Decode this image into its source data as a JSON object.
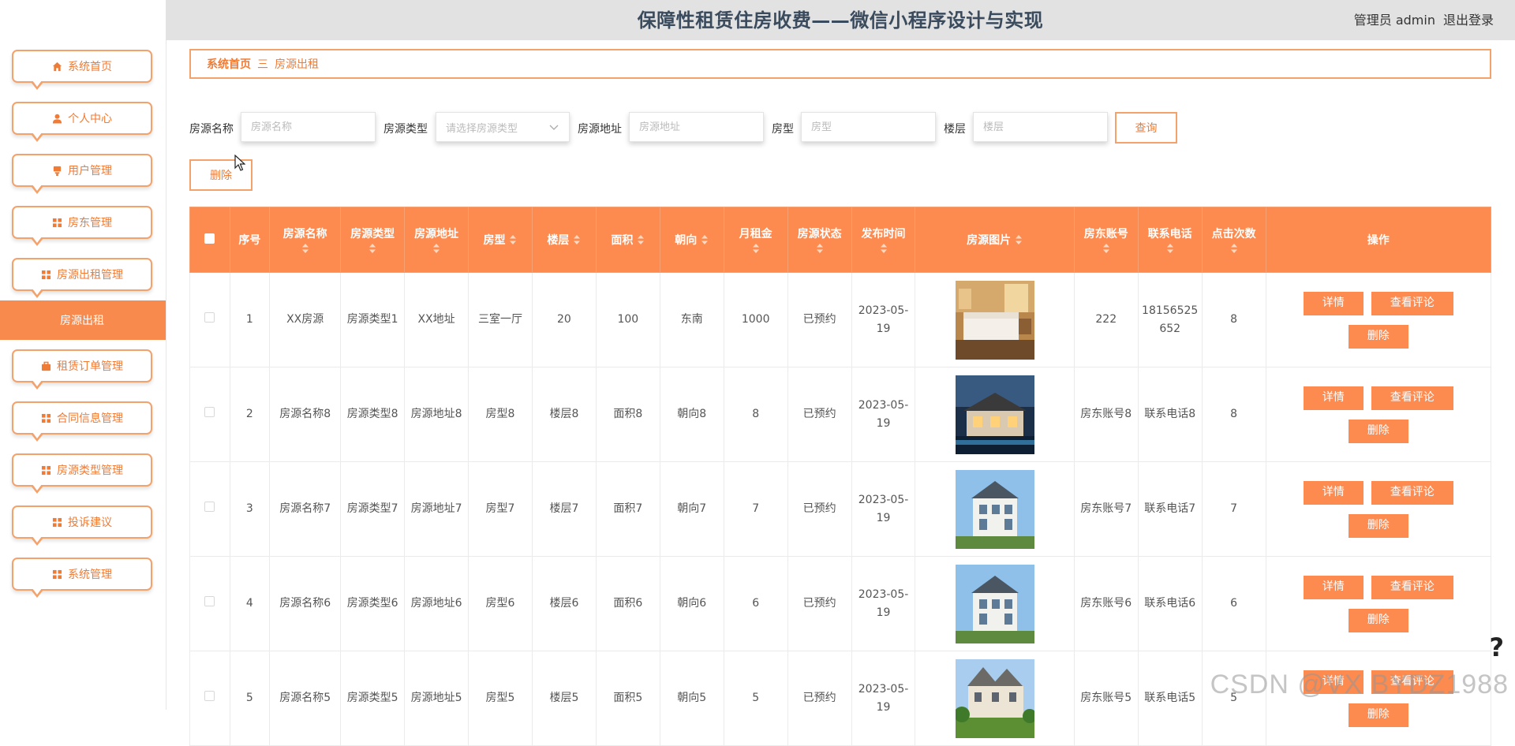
{
  "header": {
    "title": "保障性租赁住房收费——微信小程序设计与实现",
    "role": "管理员 admin",
    "logout": "退出登录"
  },
  "sidebar": {
    "items": [
      {
        "label": "系统首页",
        "icon": "home-icon"
      },
      {
        "label": "个人中心",
        "icon": "user-icon"
      },
      {
        "label": "用户管理",
        "icon": "user-manage-icon"
      },
      {
        "label": "房东管理",
        "icon": "grid-icon"
      },
      {
        "label": "房源出租管理",
        "icon": "grid-icon"
      },
      {
        "label": "租赁订单管理",
        "icon": "briefcase-icon"
      },
      {
        "label": "合同信息管理",
        "icon": "grid-icon"
      },
      {
        "label": "房源类型管理",
        "icon": "grid-icon"
      },
      {
        "label": "投诉建议",
        "icon": "grid-icon"
      },
      {
        "label": "系统管理",
        "icon": "grid-icon"
      }
    ],
    "active": "房源出租"
  },
  "breadcrumb": {
    "home": "系统首页",
    "sep": "三",
    "current": "房源出租"
  },
  "search": {
    "name_label": "房源名称",
    "name_placeholder": "房源名称",
    "type_label": "房源类型",
    "type_placeholder": "请选择房源类型",
    "addr_label": "房源地址",
    "addr_placeholder": "房源地址",
    "layout_label": "房型",
    "layout_placeholder": "房型",
    "floor_label": "楼层",
    "floor_placeholder": "楼层",
    "query_button": "查询",
    "delete_button": "删除"
  },
  "table": {
    "columns": [
      "序号",
      "房源名称",
      "房源类型",
      "房源地址",
      "房型",
      "楼层",
      "面积",
      "朝向",
      "月租金",
      "房源状态",
      "发布时间",
      "房源图片",
      "房东账号",
      "联系电话",
      "点击次数",
      "操作"
    ],
    "actions": {
      "detail": "详情",
      "comments": "查看评论",
      "delete": "删除"
    },
    "rows": [
      {
        "no": "1",
        "name": "XX房源",
        "type": "房源类型1",
        "addr": "XX地址",
        "layout": "三室一厅",
        "floor": "20",
        "area": "100",
        "orient": "东南",
        "rent": "1000",
        "status": "已预约",
        "time": "2023-05-19",
        "image": "hotel-room",
        "owner": "222",
        "phone": "18156525652",
        "clicks": "8"
      },
      {
        "no": "2",
        "name": "房源名称8",
        "type": "房源类型8",
        "addr": "房源地址8",
        "layout": "房型8",
        "floor": "楼层8",
        "area": "面积8",
        "orient": "朝向8",
        "rent": "8",
        "status": "已预约",
        "time": "2023-05-19",
        "image": "villa-night",
        "owner": "房东账号8",
        "phone": "联系电话8",
        "clicks": "8"
      },
      {
        "no": "3",
        "name": "房源名称7",
        "type": "房源类型7",
        "addr": "房源地址7",
        "layout": "房型7",
        "floor": "楼层7",
        "area": "面积7",
        "orient": "朝向7",
        "rent": "7",
        "status": "已预约",
        "time": "2023-05-19",
        "image": "villa-white",
        "owner": "房东账号7",
        "phone": "联系电话7",
        "clicks": "7"
      },
      {
        "no": "4",
        "name": "房源名称6",
        "type": "房源类型6",
        "addr": "房源地址6",
        "layout": "房型6",
        "floor": "楼层6",
        "area": "面积6",
        "orient": "朝向6",
        "rent": "6",
        "status": "已预约",
        "time": "2023-05-19",
        "image": "villa-white",
        "owner": "房东账号6",
        "phone": "联系电话6",
        "clicks": "6"
      },
      {
        "no": "5",
        "name": "房源名称5",
        "type": "房源类型5",
        "addr": "房源地址5",
        "layout": "房型5",
        "floor": "楼层5",
        "area": "面积5",
        "orient": "朝向5",
        "rent": "5",
        "status": "已预约",
        "time": "2023-05-19",
        "image": "villa-garden",
        "owner": "房东账号5",
        "phone": "联系电话5",
        "clicks": "5"
      }
    ]
  },
  "watermark": "CSDN @VX BYDZ1988",
  "colors": {
    "accent": "#fd8b50",
    "accent_border": "#f4a26b",
    "accent_text": "#f07b35"
  }
}
